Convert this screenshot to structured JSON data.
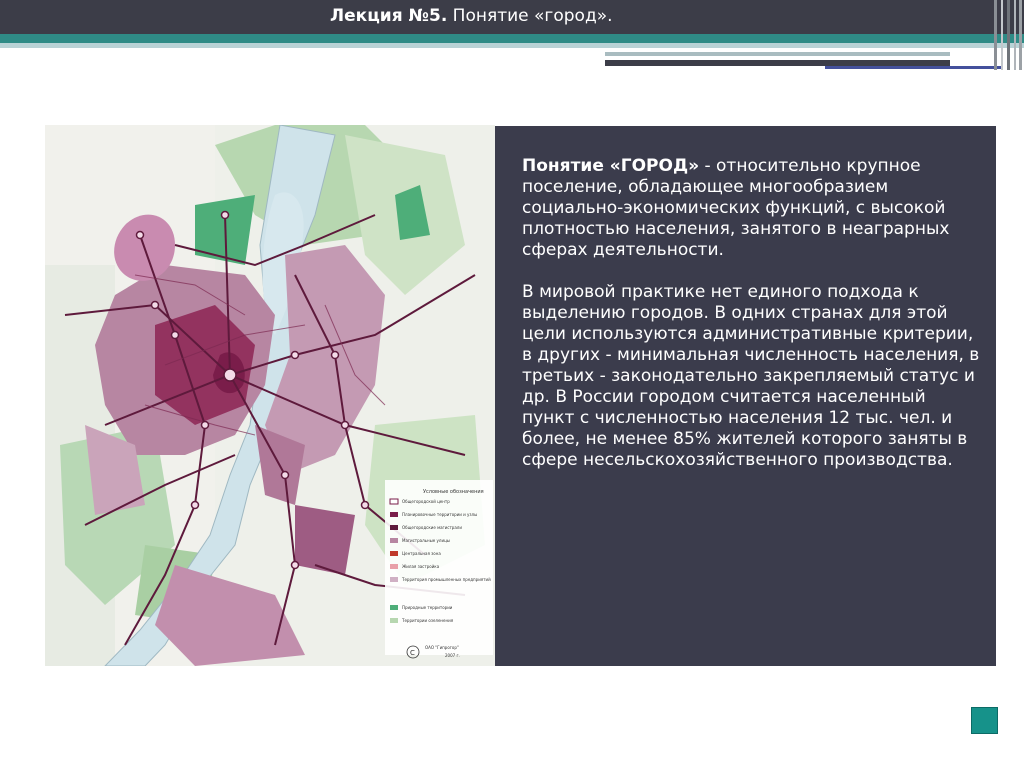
{
  "header": {
    "title_bold": "Лекция №5.",
    "title_rest": " Понятие «город»."
  },
  "colors": {
    "topbar": "#3c3d48",
    "teal_stripe": "#2f8b86",
    "panel": "#3b3c4c",
    "corner_square": "#16928a",
    "map_urban": "#8e2e5c",
    "map_green": "#6fbf8e",
    "map_water": "#cfe3ea"
  },
  "map": {
    "legend_title": "Условные обозначения",
    "legend_items": [
      "Общегородской центр",
      "Планировочные территории и узлы",
      "Общегородские магистрали",
      "Магистральные улицы",
      "Центральная зона",
      "Жилая застройка",
      "Территория промышленных предприятий",
      "Природные территории",
      "Территории озеленения"
    ],
    "stamp_line1": "ОАО \"Гипрогор\"",
    "stamp_line2": "2007 г."
  },
  "panel": {
    "p1_bold": "Понятие «ГОРОД»",
    "p1_rest": " -  относительно крупное поселение, обладающее многообразием социально-экономических функций, с высокой плотностью населения, занятого в неаграрных сферах деятельности.",
    "p2": "В мировой практике нет единого подхода к выделению городов. В одних странах для этой цели используются административные критерии, в других - минимальная численность населения, в третьих - законодательно закрепляемый статус и др. В России городом считается населенный пункт с численностью населения 12 тыс. чел. и более, не менее 85% жителей которого заняты в сфере несельскохозяйственного производства."
  }
}
